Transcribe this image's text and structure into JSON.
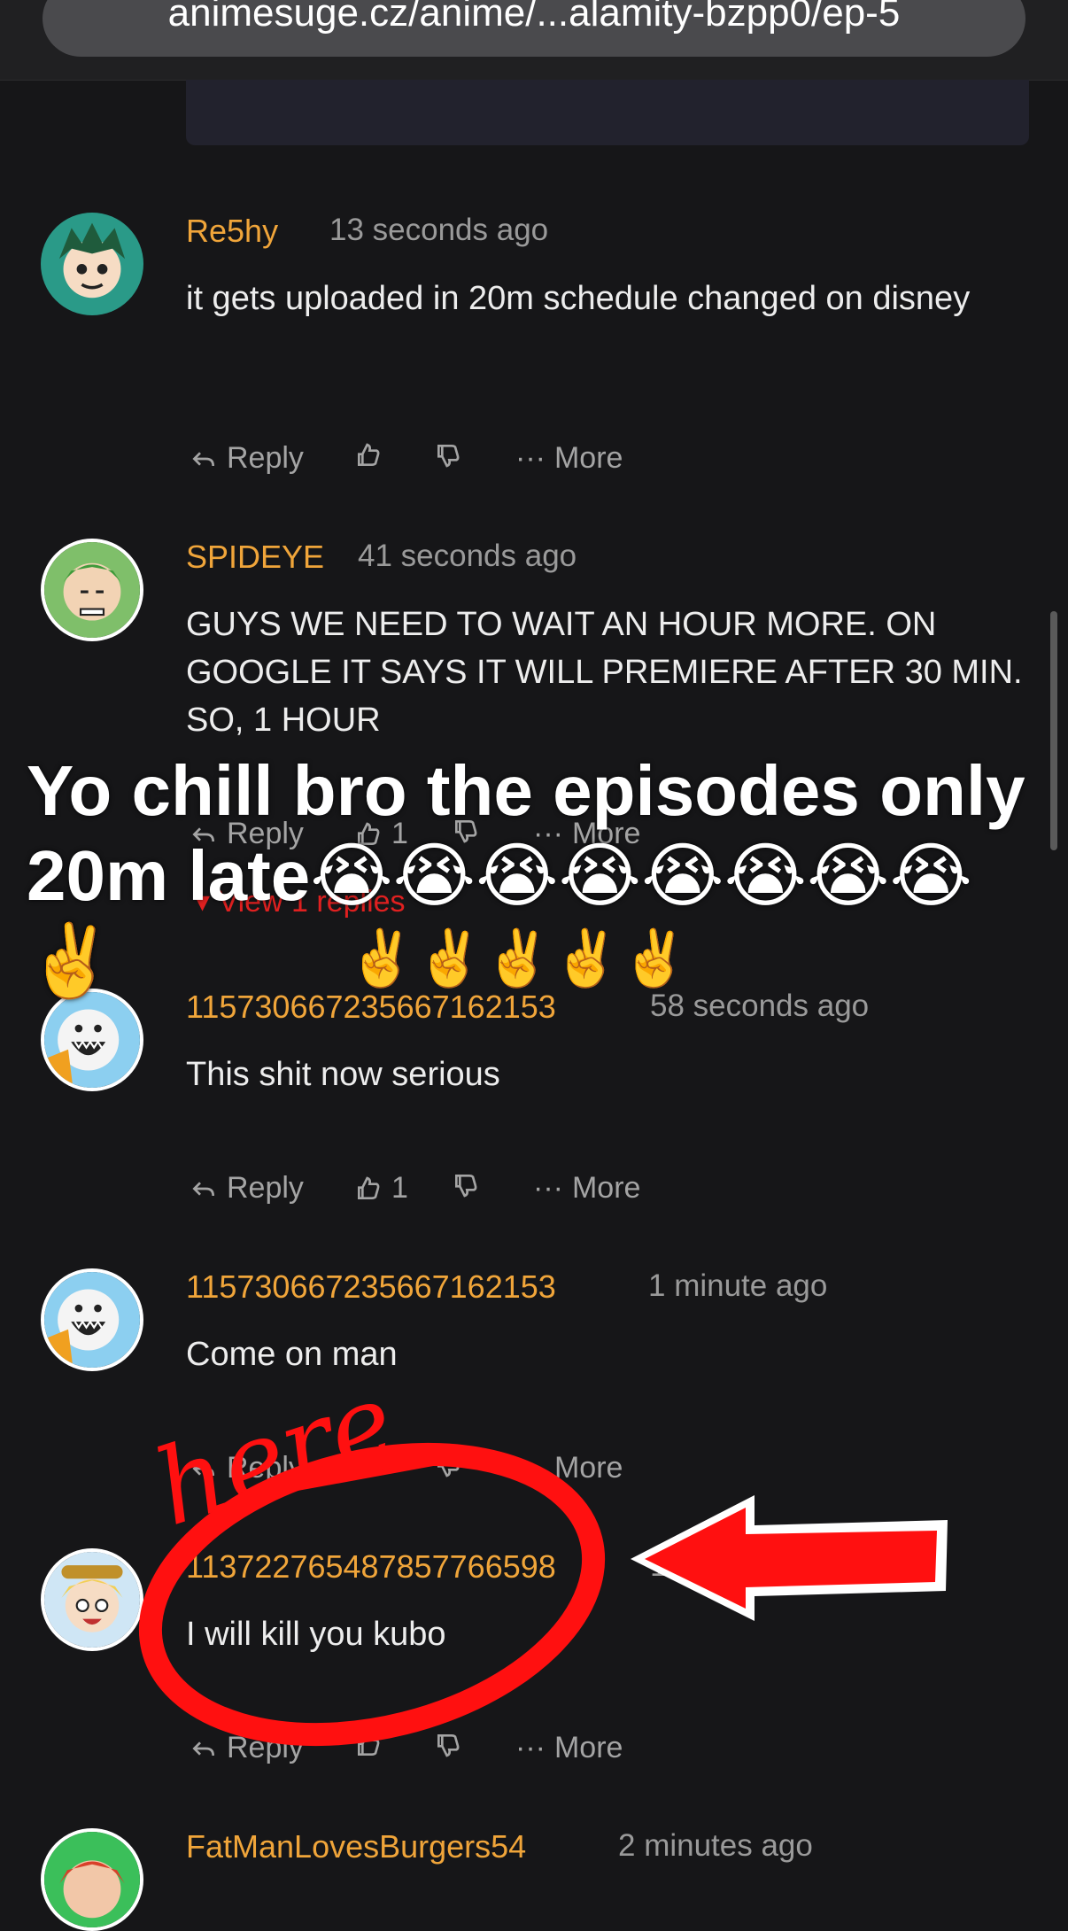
{
  "browser": {
    "url": "animesuge.cz/anime/...alamity-bzpp0/ep-5"
  },
  "actions": {
    "reply": "Reply",
    "more": "More"
  },
  "comments": [
    {
      "user": "Re5hy",
      "time": "13 seconds ago",
      "text": "it gets uploaded in 20m schedule changed on disney",
      "likes": ""
    },
    {
      "user": "SPIDEYE",
      "time": "41 seconds ago",
      "text": "GUYS WE NEED TO WAIT AN HOUR MORE. ON GOOGLE IT SAYS IT WILL PREMIERE AFTER 30 MIN. SO, 1 HOUR",
      "likes": "1",
      "view_replies": "View 1 replies"
    },
    {
      "user": "115730667235667162153",
      "time": "58 seconds ago",
      "text": "This shit now serious",
      "likes": "1"
    },
    {
      "user": "115730667235667162153",
      "time": "1 minute ago",
      "text": "Come on man",
      "likes": ""
    },
    {
      "user": "113722765487857766598",
      "time": "1 minute ago",
      "text": "I will kill you kubo",
      "likes": ""
    },
    {
      "user": "FatManLovesBurgers54",
      "time": "2 minutes ago",
      "text": "",
      "likes": ""
    }
  ],
  "overlay": {
    "caption": "Yo chill bro the episodes only 20m late😭😭😭😭😭😭😭😭✌️",
    "caption_emoji": "✌️✌️✌️✌️✌️",
    "annotation": "here"
  },
  "colors": {
    "username": "#f0a53a",
    "background": "#161618",
    "annotation_red": "#ff1010"
  }
}
